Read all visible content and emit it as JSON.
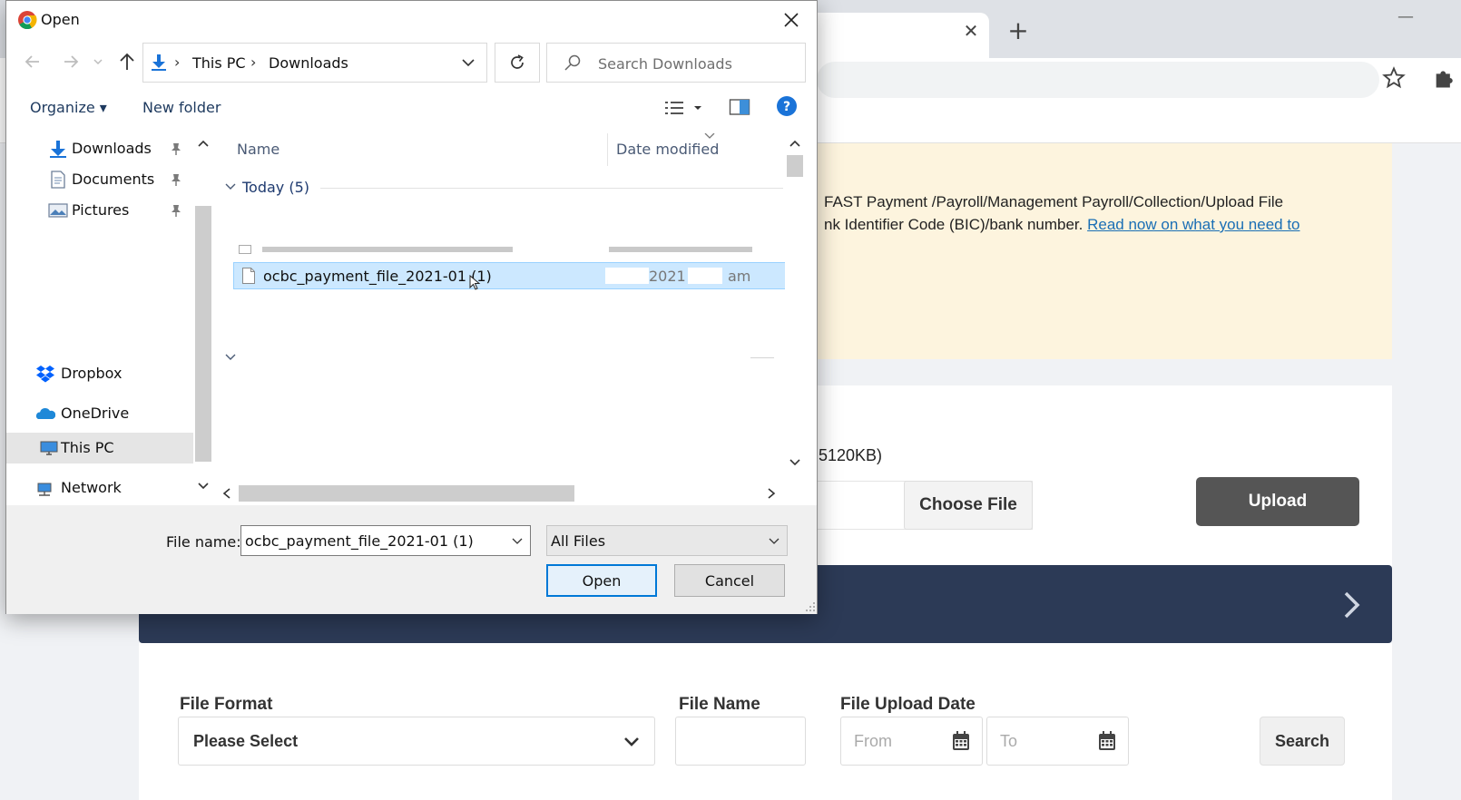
{
  "browser": {
    "tab_close": "✕",
    "new_tab": "+",
    "minimize": "—"
  },
  "page": {
    "notice_line1": "FAST Payment /Payroll/Management Payroll/Collection/Upload File",
    "notice_line2": "nk Identifier Code (BIC)/bank number.",
    "notice_link": "Read now on what you need to",
    "size_hint": "5120KB)",
    "choose_file": "Choose File",
    "upload": "Upload",
    "file_format_label": "File Format",
    "file_format_value": "Please Select",
    "file_name_label": "File Name",
    "file_upload_date_label": "File Upload Date",
    "from_placeholder": "From",
    "to_placeholder": "To",
    "search": "Search"
  },
  "dialog": {
    "title": "Open",
    "path": [
      "This PC",
      "Downloads"
    ],
    "search_placeholder": "Search Downloads",
    "organize": "Organize ▾",
    "new_folder": "New folder",
    "nav_items": [
      {
        "label": "Downloads",
        "icon": "download-arrow-icon",
        "pinned": true
      },
      {
        "label": "Documents",
        "icon": "documents-icon",
        "pinned": true
      },
      {
        "label": "Pictures",
        "icon": "pictures-icon",
        "pinned": true
      },
      {
        "label": "Dropbox",
        "icon": "dropbox-icon"
      },
      {
        "label": "OneDrive",
        "icon": "onedrive-icon"
      },
      {
        "label": "This PC",
        "icon": "this-pc-icon",
        "selected": true
      },
      {
        "label": "Network",
        "icon": "network-icon"
      }
    ],
    "columns": {
      "name": "Name",
      "date_modified": "Date modified"
    },
    "group_label": "Today (5)",
    "selected_file": {
      "name": "ocbc_payment_file_2021-01 (1)",
      "date_year": "2021",
      "date_ampm": "am"
    },
    "file_name_label": "File name:",
    "file_name_value": "ocbc_payment_file_2021-01 (1)",
    "file_type": "All Files",
    "open": "Open",
    "cancel": "Cancel"
  },
  "colors": {
    "accent_blue": "#0078d7",
    "selection": "#cce8ff",
    "banner_navy": "#2c3a56",
    "notice_bg": "#fdf4de",
    "link": "#1a6fb5"
  }
}
